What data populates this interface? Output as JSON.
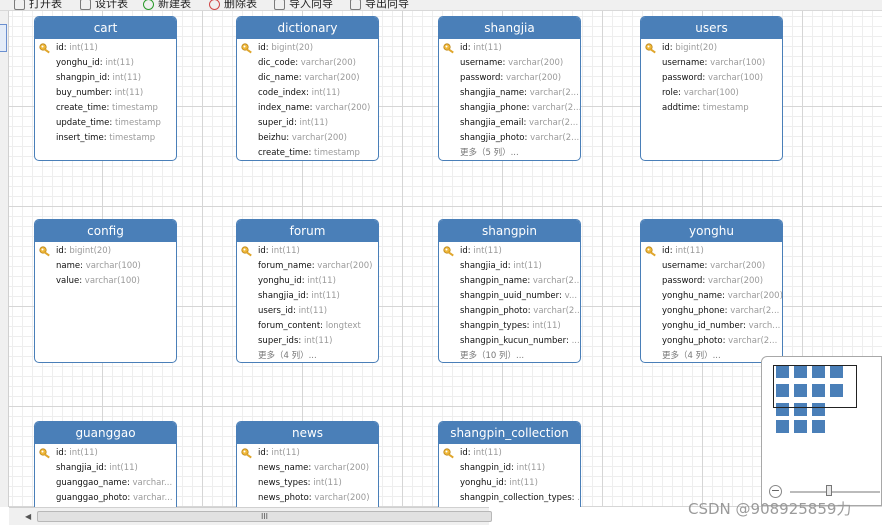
{
  "toolbar": {
    "items": [
      {
        "label": "打开表",
        "icon": "open-table-icon"
      },
      {
        "label": "设计表",
        "icon": "design-table-icon"
      },
      {
        "label": "新建表",
        "icon": "add-table-icon"
      },
      {
        "label": "删除表",
        "icon": "delete-table-icon"
      },
      {
        "label": "导入向导",
        "icon": "import-wizard-icon"
      },
      {
        "label": "导出向导",
        "icon": "export-wizard-icon"
      }
    ]
  },
  "entities": [
    {
      "name": "cart",
      "fields": [
        {
          "name": "id",
          "type": "int(11)",
          "pk": true
        },
        {
          "name": "yonghu_id",
          "type": "int(11)"
        },
        {
          "name": "shangpin_id",
          "type": "int(11)"
        },
        {
          "name": "buy_number",
          "type": "int(11)"
        },
        {
          "name": "create_time",
          "type": "timestamp"
        },
        {
          "name": "update_time",
          "type": "timestamp"
        },
        {
          "name": "insert_time",
          "type": "timestamp"
        }
      ]
    },
    {
      "name": "dictionary",
      "fields": [
        {
          "name": "id",
          "type": "bigint(20)",
          "pk": true
        },
        {
          "name": "dic_code",
          "type": "varchar(200)"
        },
        {
          "name": "dic_name",
          "type": "varchar(200)"
        },
        {
          "name": "code_index",
          "type": "int(11)"
        },
        {
          "name": "index_name",
          "type": "varchar(200)"
        },
        {
          "name": "super_id",
          "type": "int(11)"
        },
        {
          "name": "beizhu",
          "type": "varchar(200)"
        },
        {
          "name": "create_time",
          "type": "timestamp"
        }
      ]
    },
    {
      "name": "shangjia",
      "fields": [
        {
          "name": "id",
          "type": "int(11)",
          "pk": true
        },
        {
          "name": "username",
          "type": "varchar(200)"
        },
        {
          "name": "password",
          "type": "varchar(200)"
        },
        {
          "name": "shangjia_name",
          "type": "varchar(2..."
        },
        {
          "name": "shangjia_phone",
          "type": "varchar(2..."
        },
        {
          "name": "shangjia_email",
          "type": "varchar(2..."
        },
        {
          "name": "shangjia_photo",
          "type": "varchar(2..."
        }
      ],
      "more": "更多（5 列）..."
    },
    {
      "name": "users",
      "fields": [
        {
          "name": "id",
          "type": "bigint(20)",
          "pk": true
        },
        {
          "name": "username",
          "type": "varchar(100)"
        },
        {
          "name": "password",
          "type": "varchar(100)"
        },
        {
          "name": "role",
          "type": "varchar(100)"
        },
        {
          "name": "addtime",
          "type": "timestamp"
        }
      ]
    },
    {
      "name": "config",
      "fields": [
        {
          "name": "id",
          "type": "bigint(20)",
          "pk": true
        },
        {
          "name": "name",
          "type": "varchar(100)"
        },
        {
          "name": "value",
          "type": "varchar(100)"
        }
      ]
    },
    {
      "name": "forum",
      "fields": [
        {
          "name": "id",
          "type": "int(11)",
          "pk": true
        },
        {
          "name": "forum_name",
          "type": "varchar(200)"
        },
        {
          "name": "yonghu_id",
          "type": "int(11)"
        },
        {
          "name": "shangjia_id",
          "type": "int(11)"
        },
        {
          "name": "users_id",
          "type": "int(11)"
        },
        {
          "name": "forum_content",
          "type": "longtext"
        },
        {
          "name": "super_ids",
          "type": "int(11)"
        }
      ],
      "more": "更多（4 列）..."
    },
    {
      "name": "shangpin",
      "fields": [
        {
          "name": "id",
          "type": "int(11)",
          "pk": true
        },
        {
          "name": "shangjia_id",
          "type": "int(11)"
        },
        {
          "name": "shangpin_name",
          "type": "varchar(2..."
        },
        {
          "name": "shangpin_uuid_number",
          "type": "v..."
        },
        {
          "name": "shangpin_photo",
          "type": "varchar(2..."
        },
        {
          "name": "shangpin_types",
          "type": "int(11)"
        },
        {
          "name": "shangpin_kucun_number",
          "type": "..."
        }
      ],
      "more": "更多（10 列）..."
    },
    {
      "name": "yonghu",
      "fields": [
        {
          "name": "id",
          "type": "int(11)",
          "pk": true
        },
        {
          "name": "username",
          "type": "varchar(200)"
        },
        {
          "name": "password",
          "type": "varchar(200)"
        },
        {
          "name": "yonghu_name",
          "type": "varchar(200)"
        },
        {
          "name": "yonghu_phone",
          "type": "varchar(2..."
        },
        {
          "name": "yonghu_id_number",
          "type": "varch..."
        },
        {
          "name": "yonghu_photo",
          "type": "varchar(2..."
        }
      ],
      "more": "更多（4 列）..."
    },
    {
      "name": "guanggao",
      "fields": [
        {
          "name": "id",
          "type": "int(11)",
          "pk": true
        },
        {
          "name": "shangjia_id",
          "type": "int(11)"
        },
        {
          "name": "guanggao_name",
          "type": "varchar..."
        },
        {
          "name": "guanggao_photo",
          "type": "varchar..."
        }
      ]
    },
    {
      "name": "news",
      "fields": [
        {
          "name": "id",
          "type": "int(11)",
          "pk": true
        },
        {
          "name": "news_name",
          "type": "varchar(200)"
        },
        {
          "name": "news_types",
          "type": "int(11)"
        },
        {
          "name": "news_photo",
          "type": "varchar(200)"
        }
      ]
    },
    {
      "name": "shangpin_collection",
      "fields": [
        {
          "name": "id",
          "type": "int(11)",
          "pk": true
        },
        {
          "name": "shangpin_id",
          "type": "int(11)"
        },
        {
          "name": "yonghu_id",
          "type": "int(11)"
        },
        {
          "name": "shangpin_collection_types",
          "type": "..."
        }
      ]
    }
  ],
  "scrollbar": {
    "thumb_label": "III"
  },
  "minimap": {
    "zoom_minus": "−"
  },
  "watermark": "CSDN @908925859力"
}
